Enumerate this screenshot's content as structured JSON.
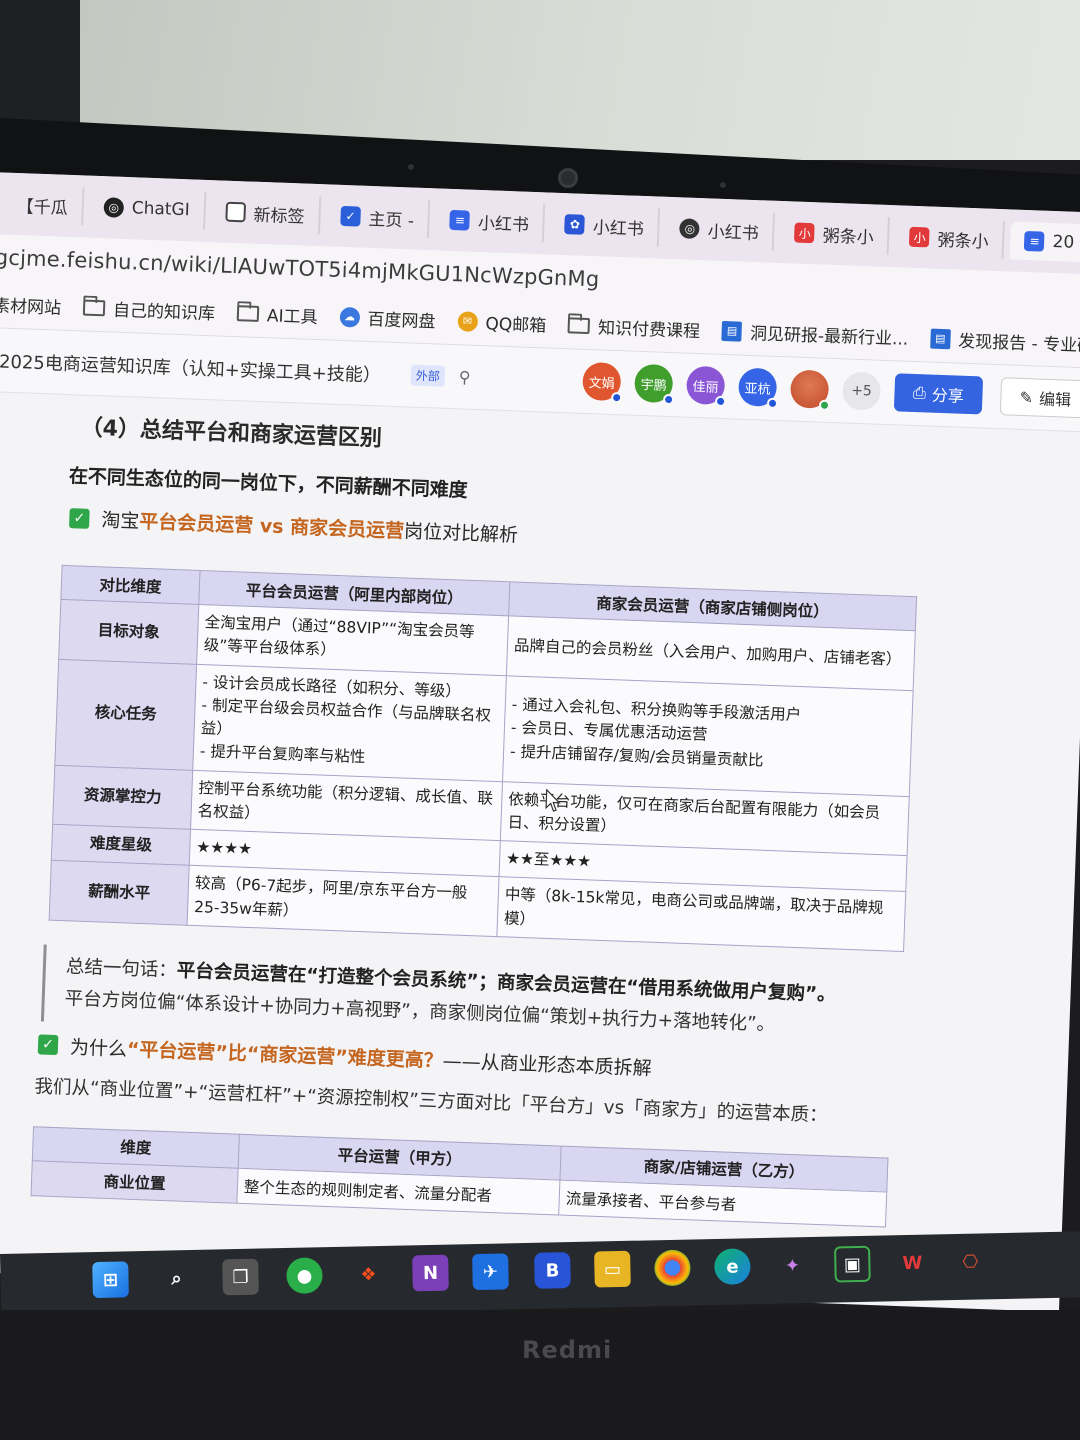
{
  "browser": {
    "tabs": [
      {
        "label": "【千瓜",
        "icon": "qiangua-icon",
        "color": "#e0662c"
      },
      {
        "label": "ChatGI",
        "icon": "chatgpt-icon",
        "color": "#222222"
      },
      {
        "label": "新标签",
        "icon": "new-tab-icon",
        "color": "#444444"
      },
      {
        "label": "主页 -",
        "icon": "home-shield-icon",
        "color": "#2b5fd9"
      },
      {
        "label": "小红书",
        "icon": "feishu-doc-icon",
        "color": "#3565e6"
      },
      {
        "label": "小红书",
        "icon": "baidu-paw-icon",
        "color": "#2b56d6"
      },
      {
        "label": "小红书",
        "icon": "chatgpt-icon",
        "color": "#333333"
      },
      {
        "label": "粥条小",
        "icon": "xhs-icon",
        "color": "#e23a3a"
      },
      {
        "label": "粥条小",
        "icon": "xhs-icon",
        "color": "#e23a3a"
      },
      {
        "label": "20",
        "icon": "feishu-doc-icon",
        "color": "#3565e6"
      }
    ],
    "close_label": "×",
    "url": "gcjme.feishu.cn/wiki/LlAUwTOT5i4mjMkGU1NcWzpGnMg",
    "bookmarks": [
      {
        "label": "素材网站",
        "icon": "none"
      },
      {
        "label": "自己的知识库",
        "icon": "folder-icon"
      },
      {
        "label": "AI工具",
        "icon": "folder-icon"
      },
      {
        "label": "百度网盘",
        "icon": "baidu-cloud-icon"
      },
      {
        "label": "QQ邮箱",
        "icon": "qq-mail-icon"
      },
      {
        "label": "知识付费课程",
        "icon": "folder-icon"
      },
      {
        "label": "洞见研报-最新行业...",
        "icon": "report-icon"
      },
      {
        "label": "发现报告 - 专业研",
        "icon": "report-icon"
      }
    ]
  },
  "doc": {
    "title": "2025电商运营知识库（认知+实操工具+技能）",
    "external_badge": "外部",
    "avatars": [
      {
        "label": "文娟",
        "color": "#e0562f"
      },
      {
        "label": "宇鹏",
        "color": "#3f9e2c"
      },
      {
        "label": "佳丽",
        "color": "#8a56d6"
      },
      {
        "label": "亚杭",
        "color": "#3565e6"
      },
      {
        "label": "",
        "color": "#d05a3b"
      }
    ],
    "more_count": "+5",
    "share_label": "分享",
    "edit_label": "编辑"
  },
  "content": {
    "section_title": "（4）总结平台和商家运营区别",
    "subtitle": "在不同生态位的同一岗位下，不同薪酬不同难度",
    "check1": {
      "prefix": "淘宝",
      "highlight": "平台会员运营 vs 商家会员运营",
      "suffix": "岗位对比解析"
    },
    "table1": {
      "headers": [
        "对比维度",
        "平台会员运营（阿里内部岗位）",
        "商家会员运营（商家店铺侧岗位）"
      ],
      "rows": [
        {
          "dim": "目标对象",
          "platform": [
            "全淘宝用户（通过“88VIP”“淘宝会员等级”等平台级体系）"
          ],
          "merchant": [
            "品牌自己的会员粉丝（入会用户、加购用户、店铺老客）"
          ]
        },
        {
          "dim": "核心任务",
          "platform": [
            "- 设计会员成长路径（如积分、等级）",
            "- 制定平台级会员权益合作（与品牌联名权益）",
            "- 提升平台复购率与粘性"
          ],
          "merchant": [
            "- 通过入会礼包、积分换购等手段激活用户",
            "- 会员日、专属优惠活动运营",
            "- 提升店铺留存/复购/会员销量贡献比"
          ]
        },
        {
          "dim": "资源掌控力",
          "platform": [
            "控制平台系统功能（积分逻辑、成长值、联名权益）"
          ],
          "merchant": [
            "依赖平台功能，仅可在商家后台配置有限能力（如会员日、积分设置）"
          ]
        },
        {
          "dim": "难度星级",
          "platform": [
            "★★★★"
          ],
          "merchant": [
            "★★至★★★"
          ]
        },
        {
          "dim": "薪酬水平",
          "platform": [
            "较高（P6-7起步，阿里/京东平台方一般25-35w年薪）"
          ],
          "merchant": [
            "中等（8k-15k常见，电商公司或品牌端，取决于品牌规模）"
          ]
        }
      ]
    },
    "quote": {
      "lead": "总结一句话：",
      "line1": "平台会员运营在“打造整个会员系统”；商家会员运营在“借用系统做用户复购”。",
      "line2": "平台方岗位偏“体系设计+协同力+高视野”，商家侧岗位偏“策划+执行力+落地转化”。"
    },
    "check2": {
      "prefix": "为什么",
      "highlight": "“平台运营”比“商家运营”难度更高？",
      "suffix": "——从商业形态本质拆解"
    },
    "paragraph": "我们从“商业位置”+“运营杠杆”+“资源控制权”三方面对比「平台方」vs「商家方」的运营本质：",
    "table2": {
      "headers": [
        "维度",
        "平台运营（甲方）",
        "商家/店铺运营（乙方）"
      ],
      "rows": [
        {
          "dim": "商业位置",
          "platform": "整个生态的规则制定者、流量分配者",
          "merchant": "流量承接者、平台参与者"
        }
      ]
    }
  },
  "device": {
    "brand": "Redmi"
  },
  "taskbar": {
    "icons": [
      "windows-start-icon",
      "search-icon",
      "task-view-icon",
      "wechat-icon",
      "figma-icon",
      "onenote-icon",
      "feishu-icon",
      "bitwarden-icon",
      "file-explorer-icon",
      "chrome-icon",
      "edge-icon",
      "app-icon",
      "monitor-app-icon",
      "wps-icon",
      "game-controller-icon"
    ]
  }
}
